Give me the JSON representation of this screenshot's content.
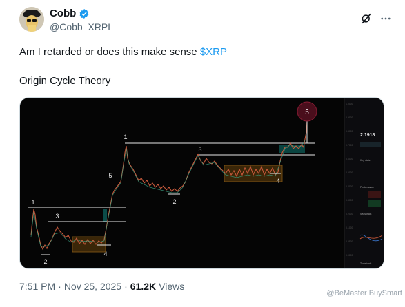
{
  "author": {
    "display_name": "Cobb",
    "handle": "@Cobb_XRPL",
    "verified": true,
    "verified_color": "#1d9bf0"
  },
  "header_icons": [
    "grok-icon",
    "more-icon"
  ],
  "tweet": {
    "text": "Am I retarded or does this make sense ",
    "cashtag": "$XRP",
    "line2": "Origin Cycle Theory"
  },
  "chart": {
    "labels": {
      "left_1": "1",
      "left_2": "2",
      "left_3": "3",
      "left_4": "4",
      "mid_5": "5",
      "right_1": "1",
      "right_2": "2",
      "right_3": "3",
      "right_4": "4",
      "circle_5": "5"
    },
    "side_panel": {
      "price": "2.1918",
      "sections": [
        "Key stats",
        "Performance",
        "Seasonals",
        "Technicals"
      ]
    }
  },
  "meta": {
    "time": "7:51 PM",
    "sep1": "·",
    "date": "Nov 25, 2025",
    "sep2": "·",
    "views_count": "61.2K",
    "views_label": "Views"
  },
  "watermark": "@BeMaster BuySmart"
}
